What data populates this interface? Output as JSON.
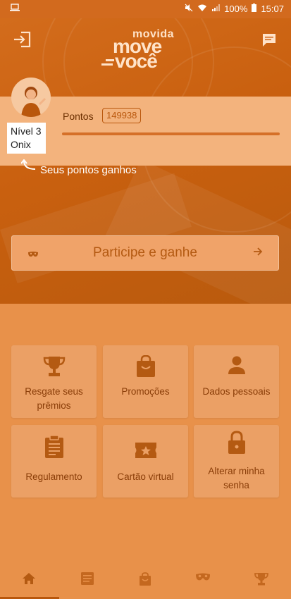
{
  "status_bar": {
    "battery": "100%",
    "time": "15:07"
  },
  "header": {
    "logo_small": "movida",
    "logo_line1": "move",
    "logo_line2": "você"
  },
  "points": {
    "label": "Pontos",
    "value": "149938",
    "level_line1": "Nível 3",
    "level_line2": "Onix",
    "hint": "Seus pontos ganhos"
  },
  "cta": {
    "label": "Participe e ganhe"
  },
  "menu": {
    "tiles": [
      {
        "label": "Resgate seus prêmios",
        "icon": "trophy-icon"
      },
      {
        "label": "Promoções",
        "icon": "shopping-bag-icon"
      },
      {
        "label": "Dados pessoais",
        "icon": "person-icon"
      },
      {
        "label": "Regulamento",
        "icon": "clipboard-icon"
      },
      {
        "label": "Cartão virtual",
        "icon": "ticket-star-icon"
      },
      {
        "label": "Alterar minha senha",
        "icon": "lock-icon"
      }
    ]
  },
  "bottom_nav": {
    "items": [
      "home-icon",
      "document-icon",
      "shopping-bag-icon",
      "mask-icon",
      "trophy-icon"
    ],
    "active_index": 0
  },
  "colors": {
    "accent": "#c9600f",
    "background": "#e8914a",
    "text_dark": "#8a3d08"
  }
}
